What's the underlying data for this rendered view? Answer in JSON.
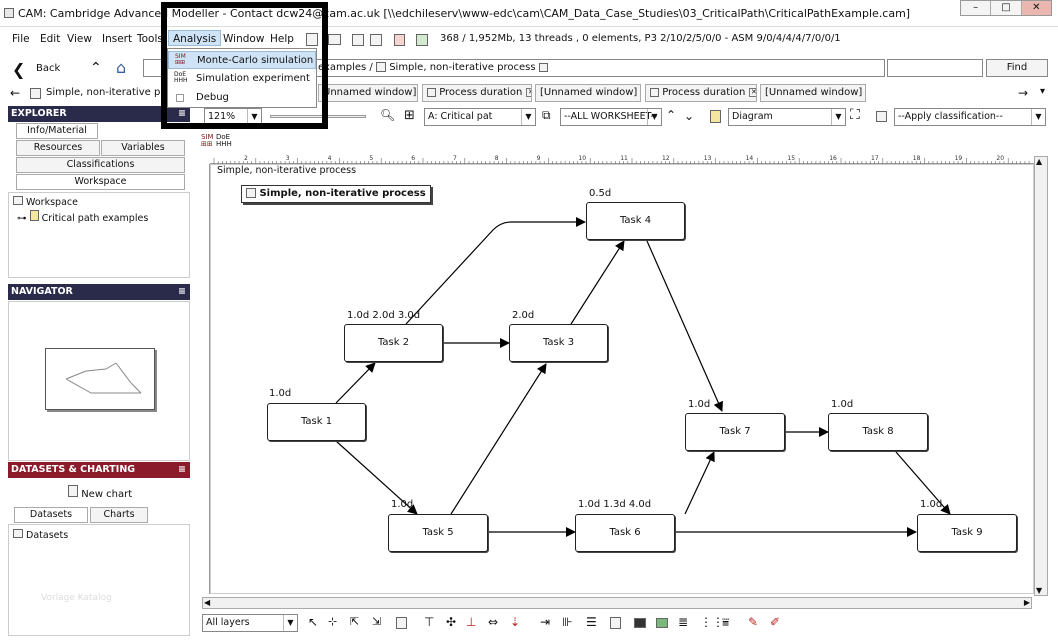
{
  "window": {
    "title": "CAM: Cambridge Advanced Modeller - Contact dcw24@cam.ac.uk [\\\\edchileserv\\www-edc\\cam\\CAM_Data_Case_Studies\\03_CriticalPath\\CriticalPathExample.cam]"
  },
  "menu": {
    "file": "File",
    "edit": "Edit",
    "view": "View",
    "insert": "Insert",
    "tools": "Tools",
    "analysis": "Analysis",
    "window": "Window",
    "help": "Help"
  },
  "status_info": "368 / 1,952Mb, 13 threads , 0 elements, P3 2/10/2/5/0/0 - ASM 9/0/4/4/4/7/0/0/1",
  "analysis_menu": {
    "items": [
      "Monte-Carlo simulation",
      "Simulation experiment",
      "Debug"
    ]
  },
  "nav": {
    "back": "Back",
    "breadcrumb_partial": "examples /",
    "breadcrumb_current": "Simple, non-iterative process",
    "find": "Find"
  },
  "tabs": {
    "current": "Simple, non-iterative process",
    "items": [
      "Unnamed window]",
      "Process duration",
      "[Unnamed window]",
      "Process duration",
      "[Unnamed window]"
    ]
  },
  "toolbar": {
    "zoom": "121%",
    "critical_path": "A: Critical pat",
    "worksheet": "--ALL WORKSHEET--",
    "view": "Diagram",
    "classification": "--Apply classification--"
  },
  "explorer": {
    "header": "EXPLORER",
    "tabs": [
      "Info/Material",
      "Resources",
      "Variables",
      "Classifications",
      "Workspace"
    ],
    "tree": [
      "Workspace",
      "Critical path examples"
    ]
  },
  "navigator": {
    "header": "NAVIGATOR"
  },
  "datasets": {
    "header": "DATASETS & CHARTING",
    "new_chart": "New chart",
    "tabs": [
      "Datasets",
      "Charts"
    ],
    "list_item": "Datasets",
    "watermark": "Vorlage Katalog"
  },
  "diagram": {
    "canvas_label": "Simple, non-iterative process",
    "title": "Simple, non-iterative process",
    "ruler_marks": [
      "2",
      "3",
      "4",
      "5",
      "6",
      "7",
      "8",
      "9",
      "10",
      "11",
      "12",
      "13",
      "14",
      "15",
      "16",
      "17",
      "18",
      "19",
      "20"
    ],
    "tasks": [
      {
        "id": "t1",
        "name": "Task 1",
        "duration": "1.0d"
      },
      {
        "id": "t2",
        "name": "Task 2",
        "duration": "1.0d 2.0d 3.0d"
      },
      {
        "id": "t3",
        "name": "Task 3",
        "duration": "2.0d"
      },
      {
        "id": "t4",
        "name": "Task 4",
        "duration": "0.5d"
      },
      {
        "id": "t5",
        "name": "Task 5",
        "duration": "1.0d"
      },
      {
        "id": "t6",
        "name": "Task 6",
        "duration": "1.0d 1.3d 4.0d"
      },
      {
        "id": "t7",
        "name": "Task 7",
        "duration": "1.0d"
      },
      {
        "id": "t8",
        "name": "Task 8",
        "duration": "1.0d"
      },
      {
        "id": "t9",
        "name": "Task 9",
        "duration": "1.0d"
      }
    ]
  },
  "bottom": {
    "layers": "All layers"
  },
  "colors": {
    "explorer_header": "#2a2a4a",
    "datasets_header": "#8b1a2a",
    "highlight_box": "#000000",
    "menu_selected": "#cfe3f7"
  }
}
